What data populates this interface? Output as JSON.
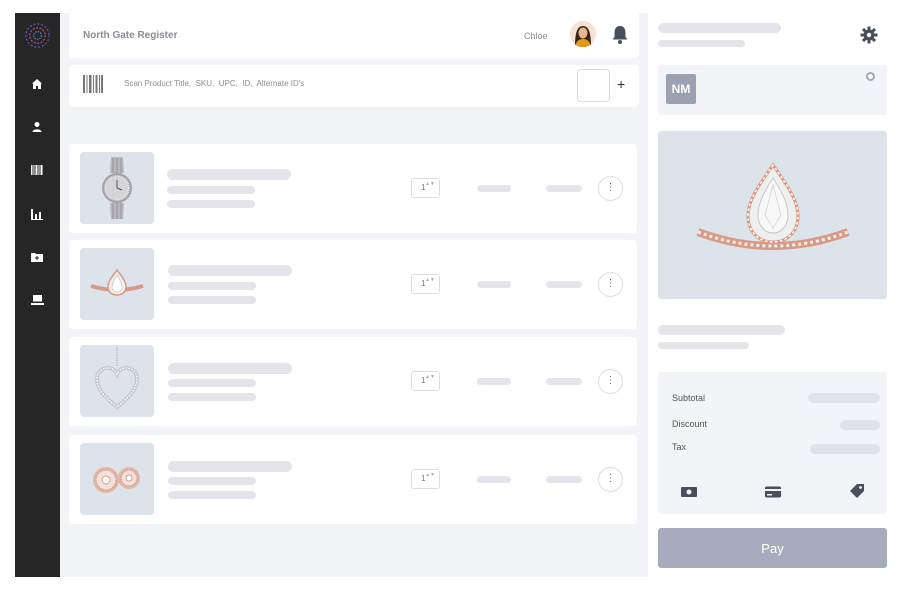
{
  "header": {
    "store_name": "North Gate Register",
    "user_name": "Chloe"
  },
  "scan": {
    "placeholder": "Scan Product Title,  SKU,  UPC,  ID,  Alternate ID's",
    "add_label": "+"
  },
  "sidebar": {
    "items": [
      {
        "name": "home",
        "icon": "home-icon"
      },
      {
        "name": "customers",
        "icon": "user-icon"
      },
      {
        "name": "inventory",
        "icon": "barcode-icon"
      },
      {
        "name": "reports",
        "icon": "chart-icon"
      },
      {
        "name": "folders",
        "icon": "folder-plus-icon"
      },
      {
        "name": "register",
        "icon": "laptop-icon"
      }
    ]
  },
  "cart": {
    "items": [
      {
        "product": "watch",
        "qty": "1"
      },
      {
        "product": "pear-ring",
        "qty": "1"
      },
      {
        "product": "heart-pendant",
        "qty": "1"
      },
      {
        "product": "stud-earrings",
        "qty": "1"
      }
    ],
    "more_label": "⋮",
    "qty_arrows": "▲▼"
  },
  "customer": {
    "initials": "NM"
  },
  "totals": {
    "subtotal_label": "Subtotal",
    "discount_label": "Discount",
    "tax_label": "Tax",
    "pay_label": "Pay"
  },
  "colors": {
    "sidebar": "#262626",
    "accent": "#a7acbd",
    "skeleton": "#e4e5ea",
    "thumb_bg": "#dde3ea",
    "rose_gold": "#d99a85"
  }
}
